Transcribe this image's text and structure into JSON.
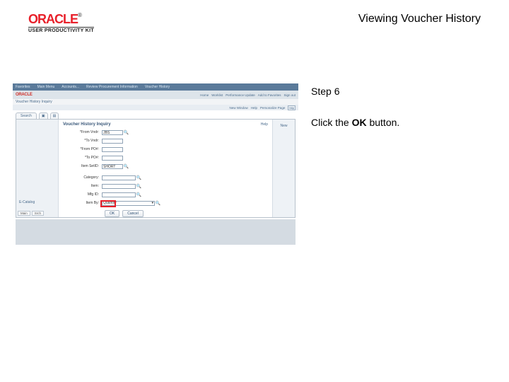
{
  "header": {
    "logo_text": "ORACLE",
    "logo_sub": "USER PRODUCTIVITY KIT",
    "title": "Viewing Voucher History"
  },
  "right": {
    "step_label": "Step 6",
    "instruction_prefix": "Click the ",
    "instruction_bold": "OK",
    "instruction_suffix": " button."
  },
  "shot": {
    "topnav": [
      "Favorites",
      "Main Menu",
      "Accounts...",
      "Review Procurement Information",
      "Voucher History"
    ],
    "brand": "ORACLE",
    "util_links": [
      "Home",
      "Worklist",
      "Performance Update",
      "Add to Favorites",
      "Sign out"
    ],
    "breadcrumb": "Voucher History Inquiry",
    "secondbar": [
      "New Window",
      "Help",
      "Personalize Page"
    ],
    "tab_search": "Search",
    "panel_title": "Voucher History Inquiry",
    "help": "Help",
    "fields": {
      "from_vndr": "*From Vndr:",
      "from_vndr_val": "JBS",
      "to_vndr": "*To Vndr:",
      "from_po": "*From PO#:",
      "to_po": "*To PO#:",
      "item_setid": "Item SetID:",
      "item_setid_val": "SHORT",
      "category": "Category:",
      "item": "Item:",
      "mfg_id": "Mfg ID:",
      "item_by": "Item By:",
      "item_by_val": "Quantity"
    },
    "btn_ok": "OK",
    "btn_cancel": "Cancel",
    "left_link": "E-Catalog",
    "left_tab1": "Main",
    "left_tab2": "Srch",
    "right_col": "New"
  }
}
